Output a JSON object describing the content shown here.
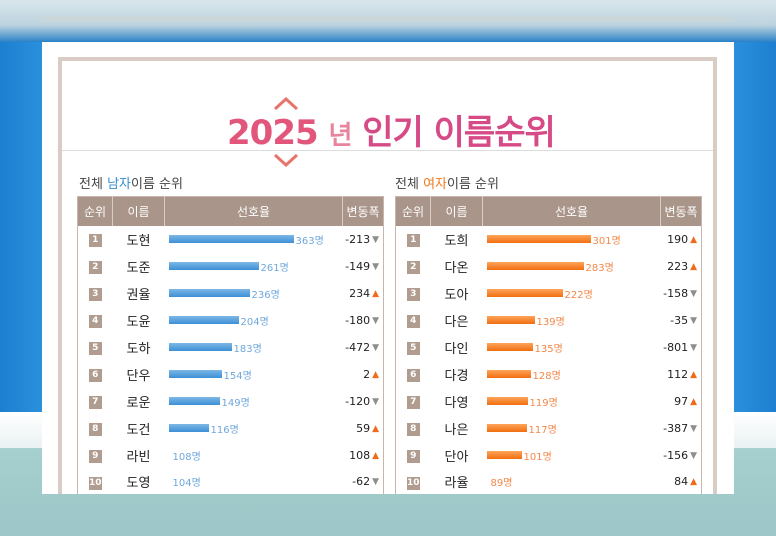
{
  "title": {
    "year": "2025",
    "nyeon": "년",
    "rest": "인기 이름순위"
  },
  "male_section": {
    "prefix": "전체 ",
    "highlight": "남자",
    "suffix": "이름 순위"
  },
  "female_section": {
    "prefix": "전체 ",
    "highlight": "여자",
    "suffix": "이름 순위"
  },
  "headers": {
    "rank": "순위",
    "name": "이름",
    "preference": "선호율",
    "change": "변동폭"
  },
  "colors": {
    "male_accent": "#2f8ed4",
    "female_accent": "#f07a1e",
    "header_bg": "#a99589"
  },
  "male_rows": [
    {
      "rank": "1",
      "name": "도현",
      "value": 363,
      "value_label": "363명",
      "change": "-213",
      "direction": "down"
    },
    {
      "rank": "2",
      "name": "도준",
      "value": 261,
      "value_label": "261명",
      "change": "-149",
      "direction": "down"
    },
    {
      "rank": "3",
      "name": "권율",
      "value": 236,
      "value_label": "236명",
      "change": "234",
      "direction": "up"
    },
    {
      "rank": "4",
      "name": "도윤",
      "value": 204,
      "value_label": "204명",
      "change": "-180",
      "direction": "down"
    },
    {
      "rank": "5",
      "name": "도하",
      "value": 183,
      "value_label": "183명",
      "change": "-472",
      "direction": "down"
    },
    {
      "rank": "6",
      "name": "단우",
      "value": 154,
      "value_label": "154명",
      "change": "2",
      "direction": "up"
    },
    {
      "rank": "7",
      "name": "로운",
      "value": 149,
      "value_label": "149명",
      "change": "-120",
      "direction": "down"
    },
    {
      "rank": "8",
      "name": "도건",
      "value": 116,
      "value_label": "116명",
      "change": "59",
      "direction": "up"
    },
    {
      "rank": "9",
      "name": "라빈",
      "value": 108,
      "value_label": "108명",
      "change": "108",
      "direction": "up"
    },
    {
      "rank": "10",
      "name": "도영",
      "value": 104,
      "value_label": "104명",
      "change": "-62",
      "direction": "down"
    }
  ],
  "female_rows": [
    {
      "rank": "1",
      "name": "도희",
      "value": 301,
      "value_label": "301명",
      "change": "190",
      "direction": "up"
    },
    {
      "rank": "2",
      "name": "다온",
      "value": 283,
      "value_label": "283명",
      "change": "223",
      "direction": "up"
    },
    {
      "rank": "3",
      "name": "도아",
      "value": 222,
      "value_label": "222명",
      "change": "-158",
      "direction": "down"
    },
    {
      "rank": "4",
      "name": "다은",
      "value": 139,
      "value_label": "139명",
      "change": "-35",
      "direction": "down"
    },
    {
      "rank": "5",
      "name": "다인",
      "value": 135,
      "value_label": "135명",
      "change": "-801",
      "direction": "down"
    },
    {
      "rank": "6",
      "name": "다경",
      "value": 128,
      "value_label": "128명",
      "change": "112",
      "direction": "up"
    },
    {
      "rank": "7",
      "name": "다영",
      "value": 119,
      "value_label": "119명",
      "change": "97",
      "direction": "up"
    },
    {
      "rank": "8",
      "name": "나은",
      "value": 117,
      "value_label": "117명",
      "change": "-387",
      "direction": "down"
    },
    {
      "rank": "9",
      "name": "단아",
      "value": 101,
      "value_label": "101명",
      "change": "-156",
      "direction": "down"
    },
    {
      "rank": "10",
      "name": "라율",
      "value": 89,
      "value_label": "89명",
      "change": "84",
      "direction": "up"
    }
  ]
}
